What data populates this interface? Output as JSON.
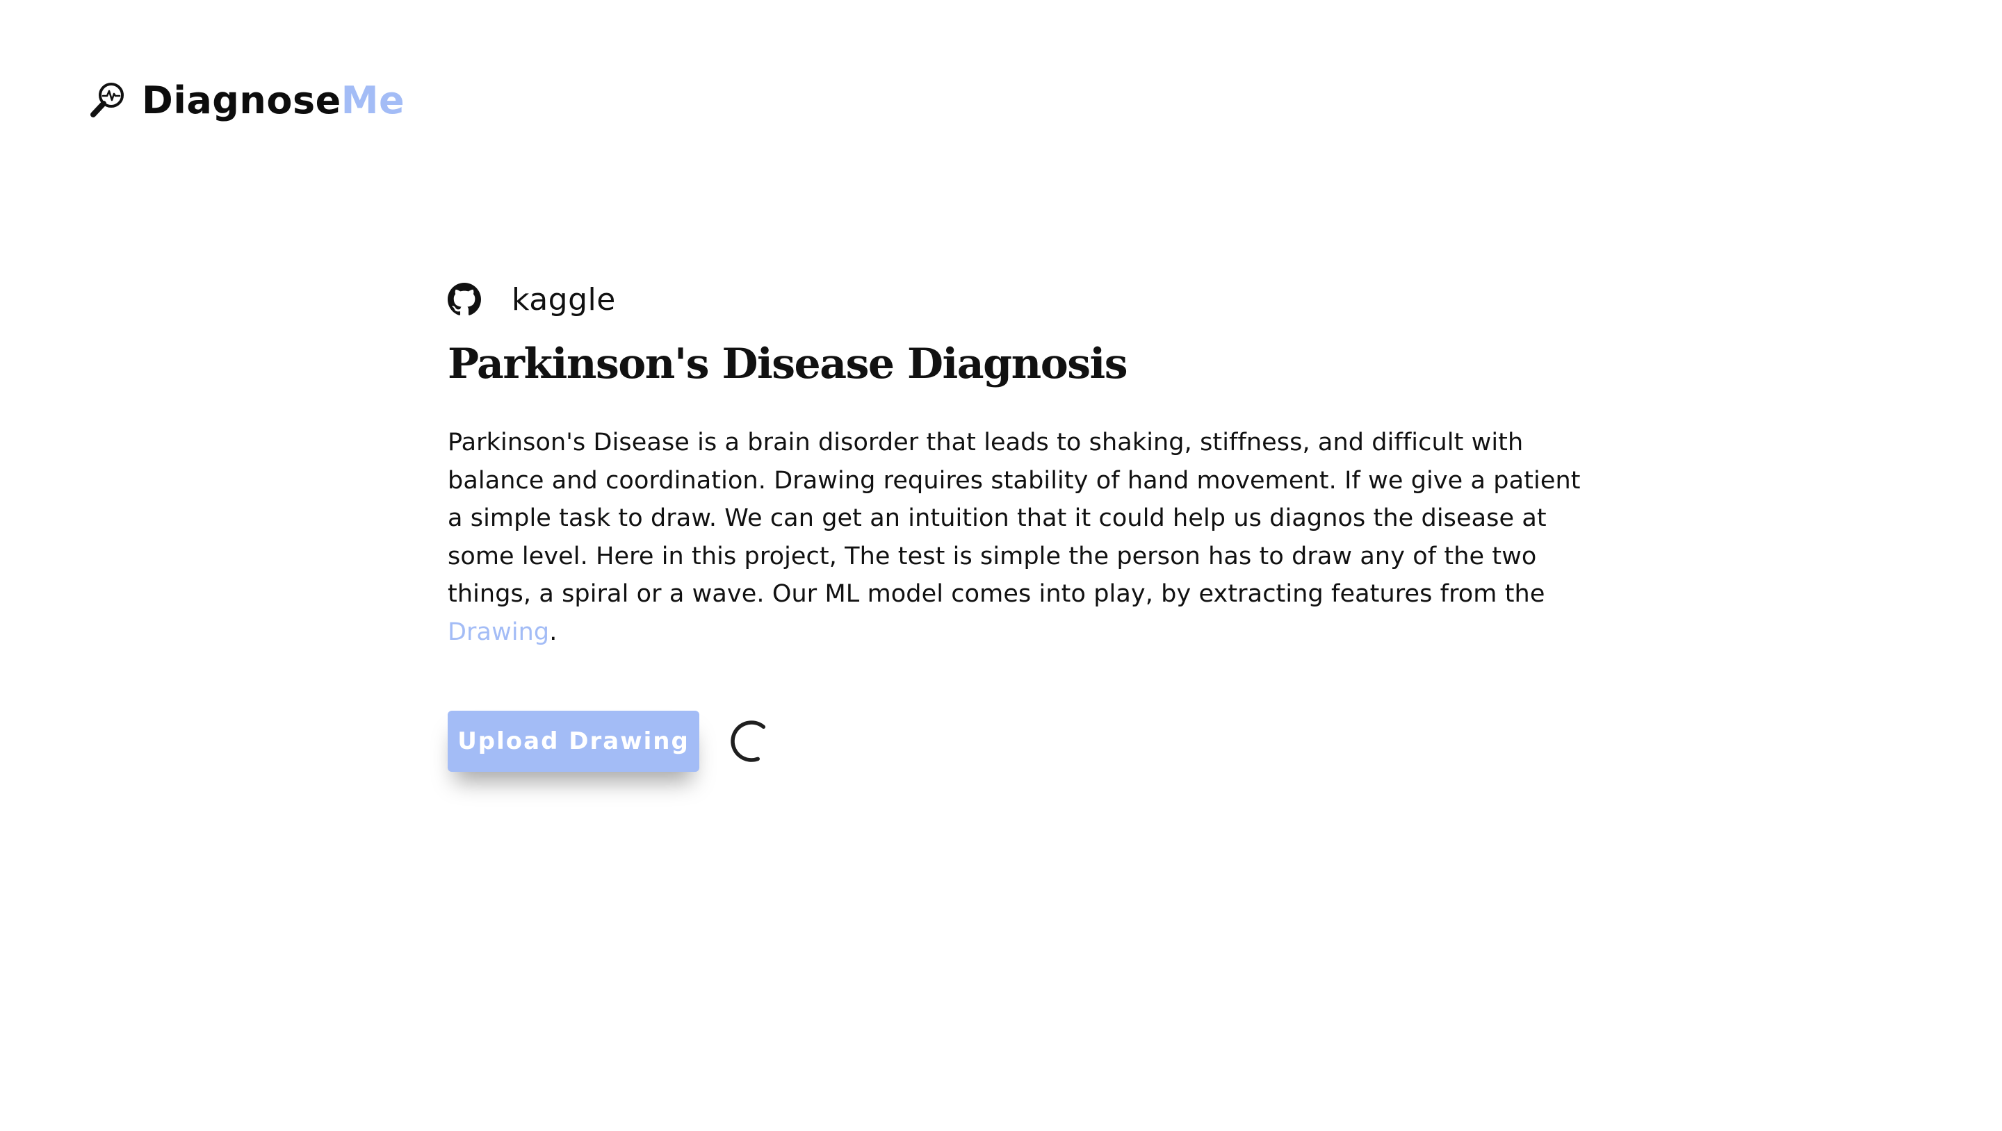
{
  "brand": {
    "name_main": "Diagnose",
    "name_accent": "Me",
    "icon": "magnifier-pulse-icon",
    "accent_color": "#a3bcf6"
  },
  "links": {
    "github_icon": "github-icon",
    "kaggle_label": "kaggle"
  },
  "page": {
    "title": "Parkinson's Disease Diagnosis",
    "description": "Parkinson's Disease is a brain disorder that leads to shaking, stiffness, and difficult with balance and coordination. Drawing requires stability of hand movement. If we give a patient a simple task to draw. We can get an intuition that it could help us diagnos the disease at some level. Here in this project, The test is simple the person has to draw any of the two things, a spiral or a wave. Our ML model comes into play, by extracting features from the",
    "description_link": "Drawing",
    "description_end": "."
  },
  "actions": {
    "upload_label": "Upload Drawing",
    "spinner_icon": "loading-spinner-icon"
  },
  "colors": {
    "accent": "#a3bcf6",
    "text": "#111111",
    "background": "#ffffff"
  }
}
